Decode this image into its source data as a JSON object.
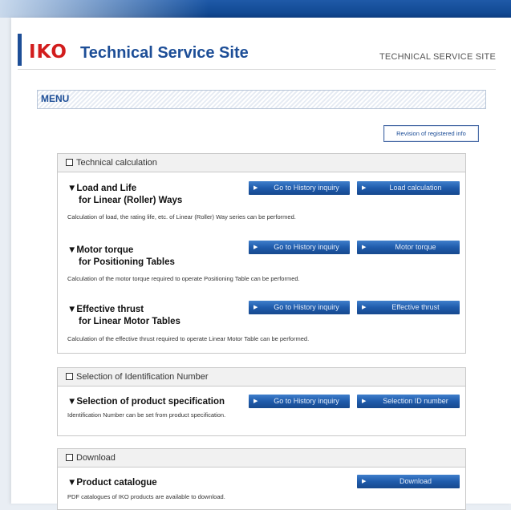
{
  "header": {
    "logo": "IKO",
    "title": "Technical Service Site",
    "tagline": "TECHNICAL SERVICE SITE"
  },
  "menu": {
    "label": "MENU"
  },
  "revision_button": "Revision of registered info",
  "sections": [
    {
      "title": "Technical calculation",
      "items": [
        {
          "title_line1": "▼Load and Life",
          "title_line2": "for Linear (Roller) Ways",
          "history_button": "Go to History inquiry",
          "action_button": "Load calculation",
          "description": "Calculation of load, the rating life, etc. of Linear (Roller) Way series can be performed."
        },
        {
          "title_line1": "▼Motor torque",
          "title_line2": "for Positioning Tables",
          "history_button": "Go to History inquiry",
          "action_button": "Motor torque",
          "description": "Calculation of the motor torque required to operate Positioning Table can be performed."
        },
        {
          "title_line1": "▼Effective thrust",
          "title_line2": "for Linear Motor Tables",
          "history_button": "Go to History inquiry",
          "action_button": "Effective thrust",
          "description": "Calculation of the effective thrust required to operate Linear Motor Table can be performed."
        }
      ]
    },
    {
      "title": "Selection of Identification Number",
      "items": [
        {
          "title_line1": "▼Selection of product specification",
          "history_button": "Go to History inquiry",
          "action_button": "Selection ID number",
          "description": "Identification Number can be set from product specification."
        }
      ]
    },
    {
      "title": "Download",
      "items": [
        {
          "title_line1": "▼Product catalogue",
          "action_button": "Download",
          "description": "PDF catalogues of IKO products are available to download."
        }
      ]
    }
  ],
  "colors": {
    "brand_blue": "#1d4e97",
    "logo_red": "#d21d1d",
    "button_blue": "#1f5bab"
  }
}
